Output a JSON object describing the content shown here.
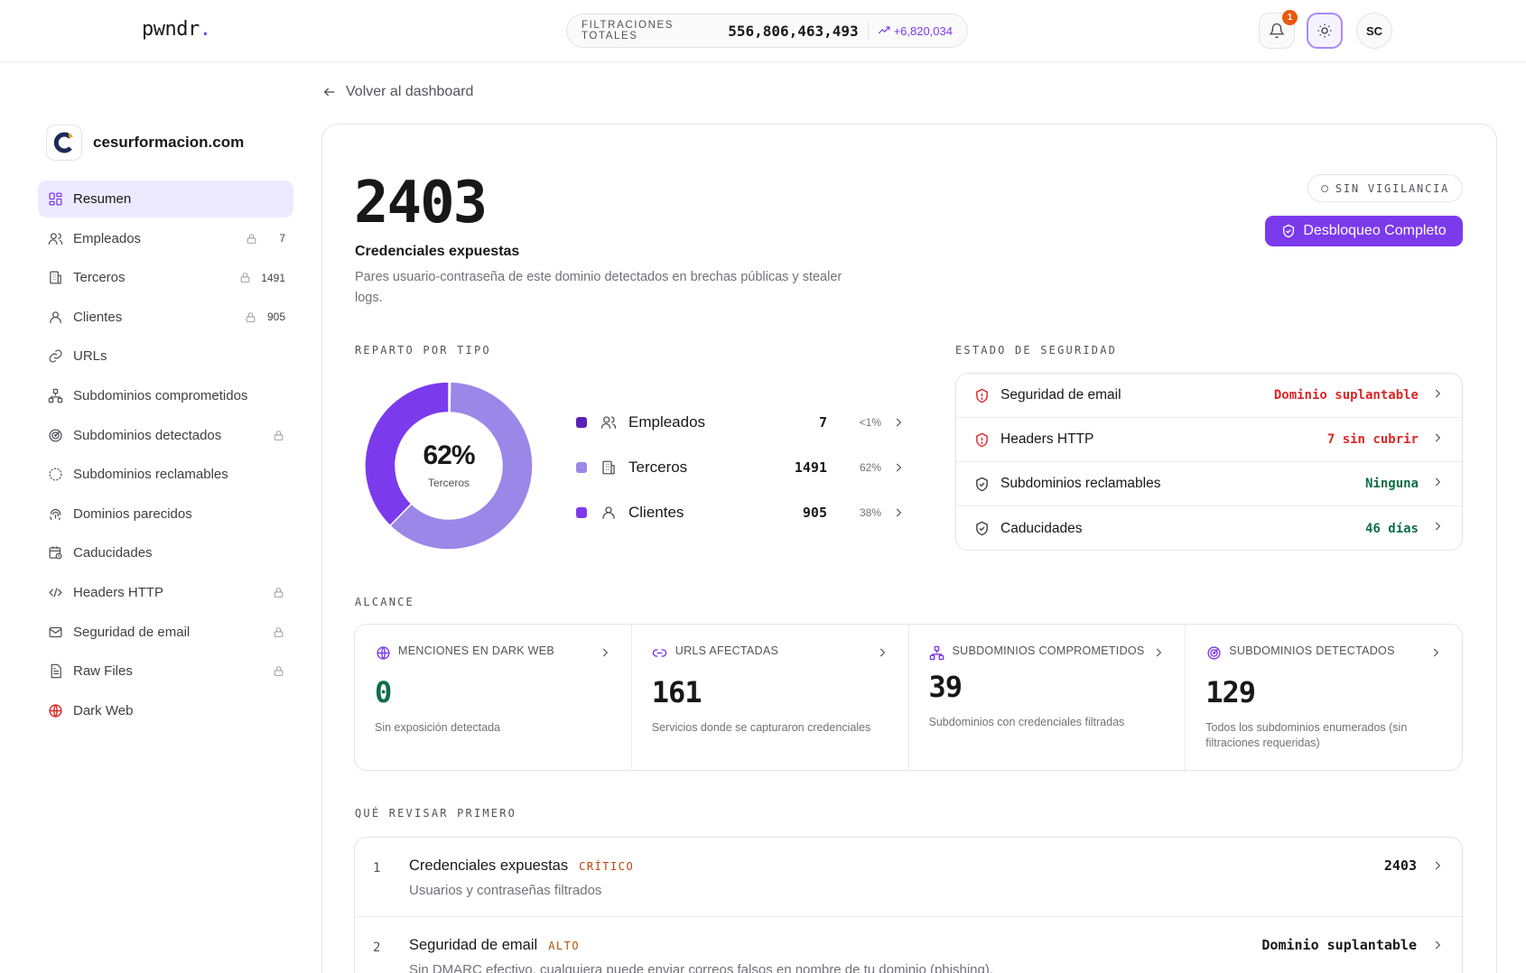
{
  "header": {
    "logo": "pwndr",
    "logo_dot": ".",
    "leaks_label": "FILTRACIONES TOTALES",
    "leaks_total": "556,806,463,493",
    "leaks_delta": "+6,820,034",
    "notifications_count": "1",
    "user_initials": "SC"
  },
  "sidebar": {
    "domain": "cesurformacion.com",
    "items": [
      {
        "label": "Resumen",
        "icon": "grid-icon",
        "active": true
      },
      {
        "label": "Empleados",
        "icon": "users-icon",
        "locked": true,
        "count": "7"
      },
      {
        "label": "Terceros",
        "icon": "building-icon",
        "locked": true,
        "count": "1491"
      },
      {
        "label": "Clientes",
        "icon": "user-icon",
        "locked": true,
        "count": "905"
      },
      {
        "label": "URLs",
        "icon": "link-icon"
      },
      {
        "label": "Subdominios comprometidos",
        "icon": "network-icon"
      },
      {
        "label": "Subdominios detectados",
        "icon": "radar-icon",
        "locked": true
      },
      {
        "label": "Subdominios reclamables",
        "icon": "broken-link-icon"
      },
      {
        "label": "Dominios parecidos",
        "icon": "fingerprint-icon"
      },
      {
        "label": "Caducidades",
        "icon": "calendar-clock-icon"
      },
      {
        "label": "Headers HTTP",
        "icon": "code-icon",
        "locked": true
      },
      {
        "label": "Seguridad de email",
        "icon": "mail-icon",
        "locked": true
      },
      {
        "label": "Raw Files",
        "icon": "file-icon",
        "locked": true
      },
      {
        "label": "Dark Web",
        "icon": "globe-icon",
        "color": "#dc2626"
      }
    ]
  },
  "back_link": "Volver al dashboard",
  "summary": {
    "total": "2403",
    "title": "Credenciales expuestas",
    "description": "Pares usuario-contraseña de este dominio detectados en brechas públicas y stealer logs.",
    "status": "SIN VIGILANCIA",
    "unlock_label": "Desbloqueo Completo"
  },
  "distribution": {
    "section_label": "REPARTO POR TIPO",
    "center_pct": "62%",
    "center_label": "Terceros",
    "rows": [
      {
        "name": "Empleados",
        "icon": "users-icon",
        "value": "7",
        "pct": "<1%",
        "color": "#5b21b6"
      },
      {
        "name": "Terceros",
        "icon": "building-icon",
        "value": "1491",
        "pct": "62%",
        "color": "#9b87e8"
      },
      {
        "name": "Clientes",
        "icon": "user-icon",
        "value": "905",
        "pct": "38%",
        "color": "#7c3aed"
      }
    ]
  },
  "chart_data": {
    "type": "pie",
    "categories": [
      "Empleados",
      "Terceros",
      "Clientes"
    ],
    "values": [
      7,
      1491,
      905
    ],
    "colors": [
      "#5b21b6",
      "#9b87e8",
      "#7c3aed"
    ]
  },
  "security": {
    "section_label": "ESTADO DE SEGURIDAD",
    "rows": [
      {
        "name": "Seguridad de email",
        "value": "Dominio suplantable",
        "status": "bad"
      },
      {
        "name": "Headers HTTP",
        "value": "7 sin cubrir",
        "status": "bad"
      },
      {
        "name": "Subdominios reclamables",
        "value": "Ninguna",
        "status": "good"
      },
      {
        "name": "Caducidades",
        "value": "46 días",
        "status": "good"
      }
    ]
  },
  "reach": {
    "section_label": "ALCANCE",
    "cells": [
      {
        "title": "MENCIONES EN DARK WEB",
        "icon": "globe-icon",
        "value": "0",
        "desc": "Sin exposición detectada"
      },
      {
        "title": "URLS AFECTADAS",
        "icon": "link-icon",
        "value": "161",
        "desc": "Servicios donde se capturaron credenciales"
      },
      {
        "title": "SUBDOMINIOS COMPROMETIDOS",
        "icon": "network-icon",
        "value": "39",
        "desc": "Subdominios con credenciales filtradas"
      },
      {
        "title": "SUBDOMINIOS DETECTADOS",
        "icon": "radar-icon",
        "value": "129",
        "desc": "Todos los subdominios enumerados (sin filtraciones requeridas)"
      }
    ]
  },
  "priorities": {
    "section_label": "QUÉ REVISAR PRIMERO",
    "rows": [
      {
        "n": "1",
        "title": "Credenciales expuestas",
        "severity": "CRÍTICO",
        "sub": "Usuarios y contraseñas filtrados",
        "value": "2403"
      },
      {
        "n": "2",
        "title": "Seguridad de email",
        "severity": "ALTO",
        "sub": "Sin DMARC efectivo, cualquiera puede enviar correos falsos en nombre de tu dominio (phishing).",
        "value": "Dominio suplantable"
      }
    ]
  }
}
